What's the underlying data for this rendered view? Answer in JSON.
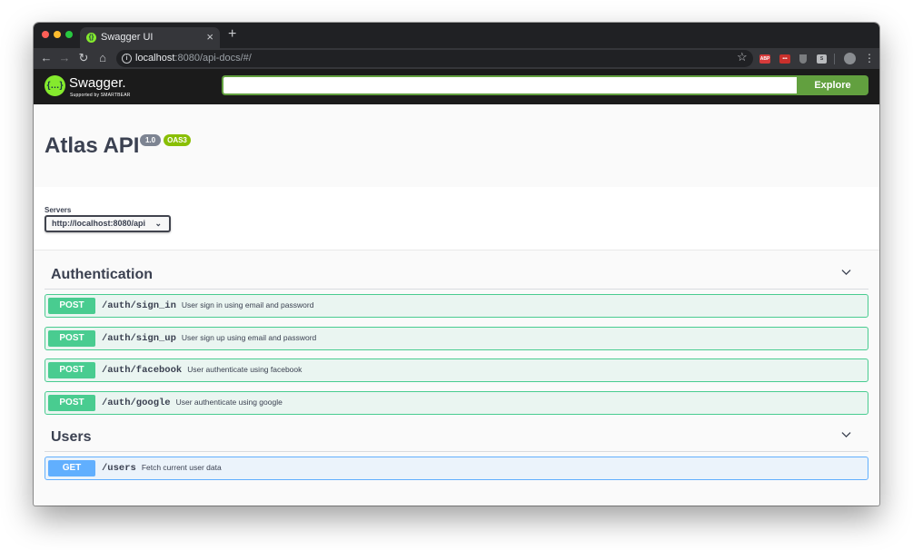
{
  "browser": {
    "tab_title": "Swagger UI",
    "tab_close": "×",
    "new_tab": "+",
    "url_host": "localhost",
    "url_path": ":8080/api-docs/#/",
    "ext_abp": "ABP",
    "ext_lastpass": "•••",
    "ext_box": "S"
  },
  "topbar": {
    "logo_mark": "{…}",
    "logo_text": "Swagger.",
    "logo_sub": "Supported by SMARTBEAR",
    "search_value": "",
    "explore_label": "Explore"
  },
  "info": {
    "title": "Atlas API",
    "version": "1.0",
    "oas": "OAS3"
  },
  "servers": {
    "label": "Servers",
    "selected": "http://localhost:8080/api"
  },
  "tags": [
    {
      "name": "Authentication",
      "operations": [
        {
          "method": "POST",
          "path": "/auth/sign_in",
          "summary": "User sign in using email and password"
        },
        {
          "method": "POST",
          "path": "/auth/sign_up",
          "summary": "User sign up using email and password"
        },
        {
          "method": "POST",
          "path": "/auth/facebook",
          "summary": "User authenticate using facebook"
        },
        {
          "method": "POST",
          "path": "/auth/google",
          "summary": "User authenticate using google"
        }
      ]
    },
    {
      "name": "Users",
      "operations": [
        {
          "method": "GET",
          "path": "/users",
          "summary": "Fetch current user data"
        }
      ]
    }
  ],
  "colors": {
    "post": "#49cc90",
    "get": "#61affe",
    "swagger_green": "#85ea2d",
    "explore_green": "#62a03f",
    "topbar_bg": "#1b1b1b"
  }
}
